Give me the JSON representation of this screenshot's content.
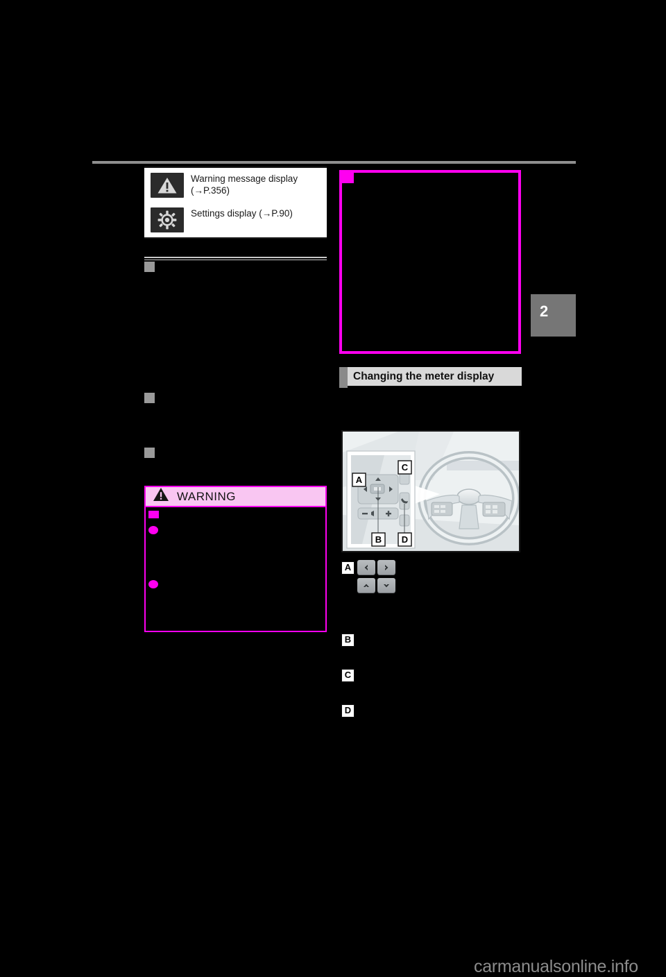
{
  "page": {
    "background_color": "#000000",
    "chapter_tab": {
      "number": "2"
    },
    "watermark": "carmanualsonline.info"
  },
  "icon_table": {
    "rows": [
      {
        "icon": "warning-triangle-icon",
        "label": "Warning message display (→P.356)",
        "reference": "P.356"
      },
      {
        "icon": "gear-settings-icon",
        "label": "Settings display (→P.90)",
        "reference": "P.90"
      }
    ]
  },
  "left_column": {
    "section_headings": [
      {
        "marker": "gray-square",
        "title": ""
      },
      {
        "marker": "gray-square",
        "title": ""
      },
      {
        "marker": "gray-square",
        "title": ""
      }
    ],
    "warning": {
      "title": "WARNING",
      "icon": "warning-triangle-icon",
      "header_bg": "#f9c6f2",
      "border_color": "#ff00f0",
      "bullets": [
        {
          "marker": "square"
        },
        {
          "marker": "dot"
        },
        {
          "marker": "dot"
        }
      ]
    }
  },
  "right_column": {
    "figure": {
      "name": "meter-display-figure",
      "border_color": "#ff00f0",
      "corner_marker": true
    },
    "section_bar": {
      "title": "Changing the meter display"
    },
    "photo": {
      "name": "steering-wheel-switch-photo",
      "callouts": [
        "A",
        "B",
        "C",
        "D"
      ]
    },
    "callouts": [
      {
        "letter": "A",
        "keys": [
          "left-arrow",
          "right-arrow",
          "up-arrow",
          "down-arrow"
        ],
        "description": ""
      },
      {
        "letter": "B",
        "description": ""
      },
      {
        "letter": "C",
        "description": ""
      },
      {
        "letter": "D",
        "description": ""
      }
    ]
  },
  "colors": {
    "accent_magenta": "#ff00f0",
    "warning_pink": "#f9c6f2",
    "bar_gray": "#d9d9d9",
    "tab_gray": "#767676",
    "marker_gray": "#9a9a9a"
  }
}
